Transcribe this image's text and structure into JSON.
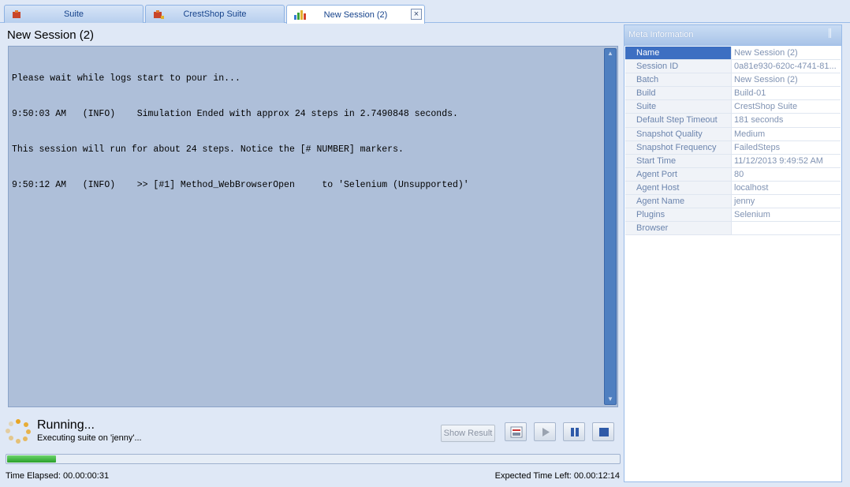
{
  "tabs": [
    {
      "label": "Suite",
      "icon": "suite-icon"
    },
    {
      "label": "CrestShop Suite",
      "icon": "suite-icon"
    },
    {
      "label": "New Session (2)",
      "icon": "bar-chart-icon",
      "close": "×"
    }
  ],
  "session": {
    "title": "New Session (2)",
    "log_lines": [
      "Please wait while logs start to pour in...",
      "9:50:03 AM   (INFO)    Simulation Ended with approx 24 steps in 2.7490848 seconds.",
      "This session will run for about 24 steps. Notice the [# NUMBER] markers.",
      "9:50:12 AM   (INFO)    >> [#1] Method_WebBrowserOpen     to 'Selenium (Unsupported)'"
    ]
  },
  "status": {
    "title": "Running...",
    "subtitle": "Executing suite on 'jenny'...",
    "show_result_label": "Show Result",
    "progress_fraction": 0.08,
    "elapsed": "Time Elapsed: 00.00:00:31",
    "expected": "Expected Time Left: 00.00:12:14"
  },
  "meta": {
    "title": "Meta Information",
    "rows": [
      {
        "key": "Name",
        "value": "New Session (2)"
      },
      {
        "key": "Session ID",
        "value": "0a81e930-620c-4741-81..."
      },
      {
        "key": "Batch",
        "value": "New Session (2)"
      },
      {
        "key": "Build",
        "value": "Build-01"
      },
      {
        "key": "Suite",
        "value": "CrestShop Suite"
      },
      {
        "key": "Default Step Timeout",
        "value": "181 seconds"
      },
      {
        "key": "Snapshot Quality",
        "value": "Medium"
      },
      {
        "key": "Snapshot Frequency",
        "value": "FailedSteps"
      },
      {
        "key": "Start Time",
        "value": "11/12/2013 9:49:52 AM"
      },
      {
        "key": "Agent Port",
        "value": "80"
      },
      {
        "key": "Agent Host",
        "value": "localhost"
      },
      {
        "key": "Agent Name",
        "value": "jenny"
      },
      {
        "key": "Plugins",
        "value": "Selenium"
      },
      {
        "key": "Browser",
        "value": ""
      }
    ]
  }
}
